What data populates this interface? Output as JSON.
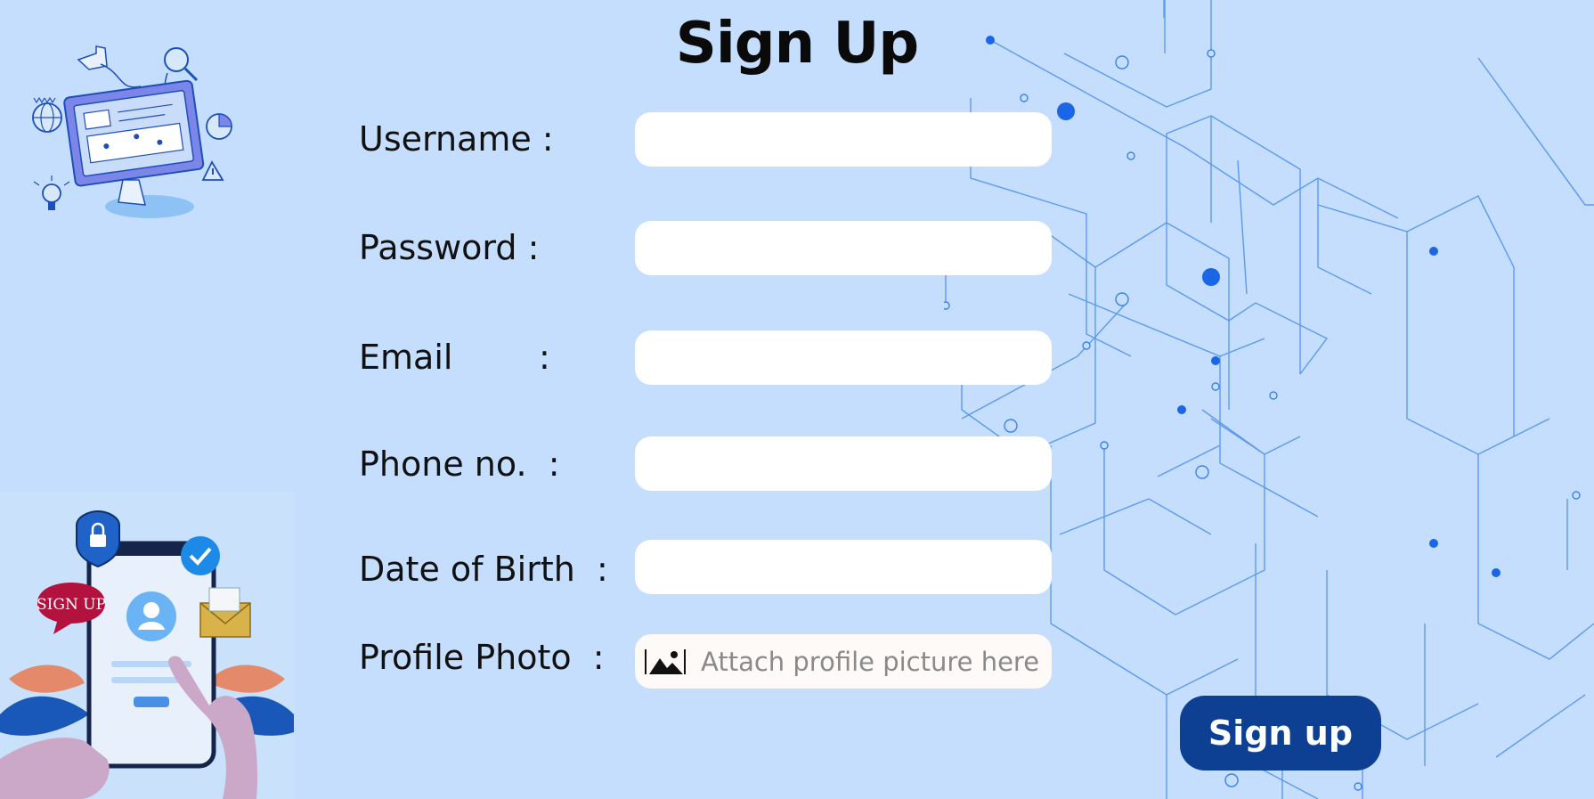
{
  "title": "Sign Up",
  "form": {
    "username_label": "Username :",
    "password_label": "Password :",
    "email_label": "Email        :",
    "phone_label": "Phone no.  :",
    "dob_label": "Date of Birth  :",
    "photo_label": "Profile Photo  :",
    "username_value": "",
    "password_value": "",
    "email_value": "",
    "phone_value": "",
    "dob_value": "",
    "photo_placeholder": "Attach profile picture here"
  },
  "submit_label": "Sign up",
  "illustration_badge": "SIGN UP",
  "icons": [
    "image-icon"
  ],
  "colors": {
    "background": "#c5defd",
    "button": "#0d3f93",
    "circuit": "#1f6fe0"
  }
}
